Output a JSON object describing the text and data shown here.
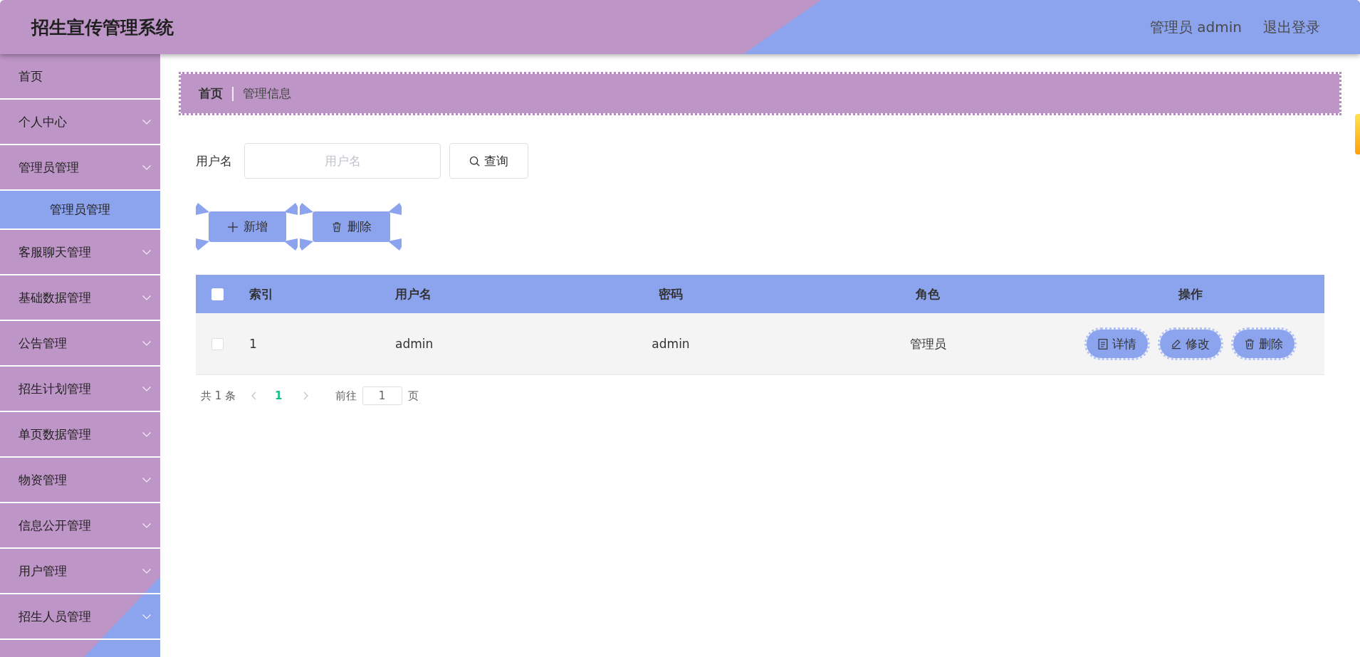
{
  "header": {
    "title": "招生宣传管理系统",
    "user": "管理员 admin",
    "logout": "退出登录"
  },
  "sidebar": {
    "items": [
      {
        "label": "首页",
        "kind": "link",
        "selected": false
      },
      {
        "label": "个人中心",
        "kind": "submenu",
        "selected": false
      },
      {
        "label": "管理员管理",
        "kind": "submenu",
        "selected": false,
        "children": [
          {
            "label": "管理员管理",
            "selected": true
          }
        ]
      },
      {
        "label": "客服聊天管理",
        "kind": "submenu",
        "selected": false
      },
      {
        "label": "基础数据管理",
        "kind": "submenu",
        "selected": false
      },
      {
        "label": "公告管理",
        "kind": "submenu",
        "selected": false
      },
      {
        "label": "招生计划管理",
        "kind": "submenu",
        "selected": false
      },
      {
        "label": "单页数据管理",
        "kind": "submenu",
        "selected": false
      },
      {
        "label": "物资管理",
        "kind": "submenu",
        "selected": false
      },
      {
        "label": "信息公开管理",
        "kind": "submenu",
        "selected": false
      },
      {
        "label": "用户管理",
        "kind": "submenu",
        "selected": false
      },
      {
        "label": "招生人员管理",
        "kind": "submenu",
        "selected": false
      }
    ]
  },
  "breadcrumb": [
    {
      "label": "首页",
      "kind": "link"
    },
    {
      "label": "管理信息",
      "kind": "current"
    }
  ],
  "search": {
    "label": "用户名",
    "placeholder": "用户名",
    "button": "查询"
  },
  "actions": [
    {
      "label": "新增",
      "kind": "add"
    },
    {
      "label": "删除",
      "kind": "delete"
    }
  ],
  "table": {
    "select_all": {
      "checked": false
    },
    "columns": [
      "索引",
      "用户名",
      "密码",
      "角色",
      "操作"
    ],
    "rows": [
      {
        "checked": false,
        "cells": [
          "1",
          "admin",
          "admin",
          "管理员"
        ],
        "actions": [
          {
            "label": "详情",
            "kind": "detail"
          },
          {
            "label": "修改",
            "kind": "edit"
          },
          {
            "label": "删除",
            "kind": "delete"
          }
        ]
      }
    ]
  },
  "pagination": {
    "total": "共 1 条",
    "pages": [
      {
        "label": "1",
        "selected": true
      }
    ],
    "goto_label": "前往",
    "goto_value": "1",
    "suffix": "页"
  }
}
